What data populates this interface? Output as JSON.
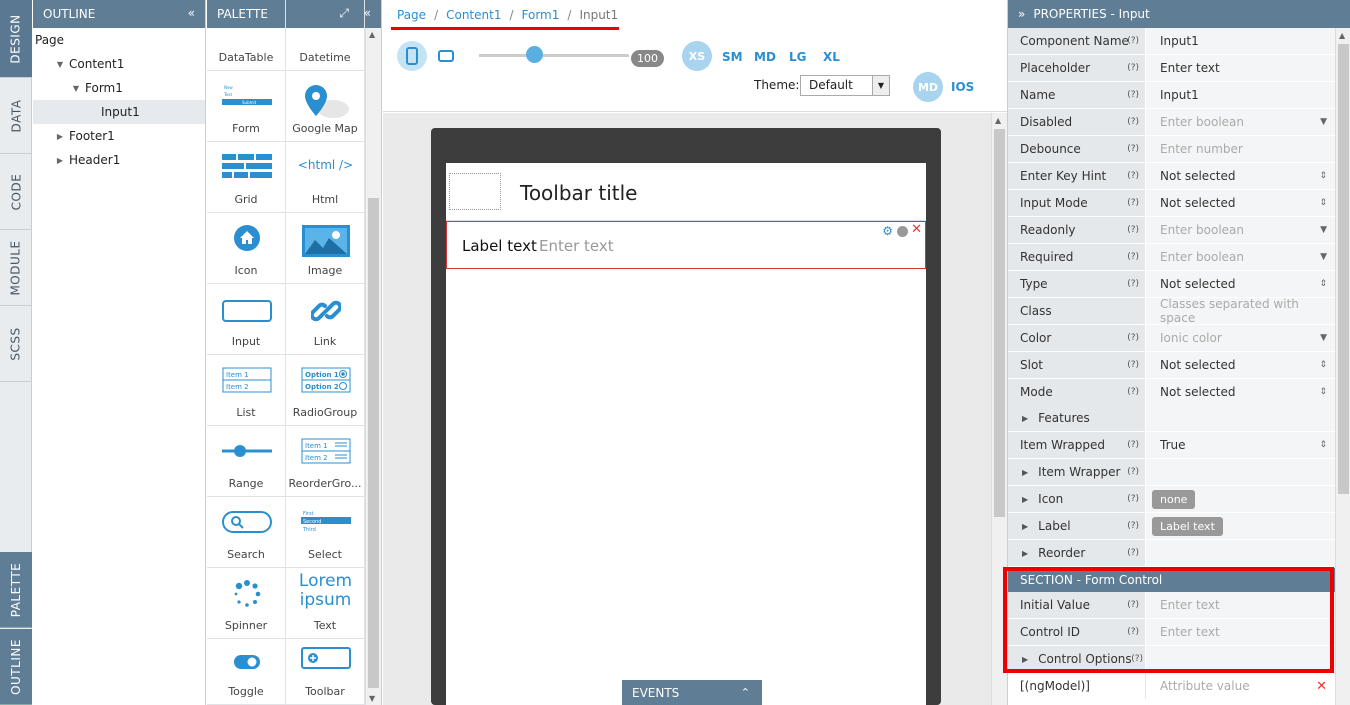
{
  "vtabs": {
    "design": "DESIGN",
    "data": "DATA",
    "code": "CODE",
    "module": "MODULE",
    "scss": "SCSS",
    "palette": "PALETTE",
    "outline": "OUTLINE"
  },
  "outline": {
    "title": "OUTLINE",
    "items": [
      {
        "label": "Page"
      },
      {
        "label": "Content1"
      },
      {
        "label": "Form1"
      },
      {
        "label": "Input1"
      },
      {
        "label": "Footer1"
      },
      {
        "label": "Header1"
      }
    ]
  },
  "palette": {
    "title": "PALETTE",
    "items": [
      {
        "label": "DataTable",
        "icon": "datatable-icon"
      },
      {
        "label": "Datetime",
        "icon": "datetime-icon"
      },
      {
        "label": "Form",
        "icon": "form-icon"
      },
      {
        "label": "Google Map",
        "icon": "map-pin-icon"
      },
      {
        "label": "Grid",
        "icon": "grid-icon"
      },
      {
        "label": "Html",
        "icon": "html-icon"
      },
      {
        "label": "Icon",
        "icon": "home-icon"
      },
      {
        "label": "Image",
        "icon": "image-icon"
      },
      {
        "label": "Input",
        "icon": "input-icon"
      },
      {
        "label": "Link",
        "icon": "link-icon"
      },
      {
        "label": "List",
        "icon": "list-icon"
      },
      {
        "label": "RadioGroup",
        "icon": "radiogroup-icon"
      },
      {
        "label": "Range",
        "icon": "range-icon"
      },
      {
        "label": "ReorderGro...",
        "icon": "reorder-icon"
      },
      {
        "label": "Search",
        "icon": "search-icon"
      },
      {
        "label": "Select",
        "icon": "select-icon"
      },
      {
        "label": "Spinner",
        "icon": "spinner-icon"
      },
      {
        "label": "Text",
        "icon": "text-icon"
      },
      {
        "label": "Toggle",
        "icon": "toggle-icon"
      },
      {
        "label": "Toolbar",
        "icon": "toolbar-icon"
      }
    ],
    "icon_text": {
      "html": "<html />",
      "lorem": "Lorem",
      "ipsum": "ipsum",
      "item1": "Item 1",
      "item2": "Item 2",
      "option1": "Option 1",
      "option2": "Option 2",
      "new": "New",
      "first": "First",
      "second": "Second",
      "third": "Third",
      "submit": "Submit"
    }
  },
  "breadcrumb": {
    "items": [
      "Page",
      "Content1",
      "Form1"
    ],
    "current": "Input1"
  },
  "toolbar": {
    "zoom": "100",
    "breakpoints": [
      "XS",
      "SM",
      "MD",
      "LG",
      "XL"
    ],
    "theme_label": "Theme:",
    "theme_value": "Default",
    "mode_md": "MD",
    "mode_ios": "IOS"
  },
  "preview": {
    "toolbar_title": "Toolbar title",
    "label_text": "Label text",
    "placeholder": "Enter text"
  },
  "events_label": "EVENTS",
  "properties": {
    "title": "PROPERTIES - Input",
    "rows": [
      {
        "label": "Component Name",
        "q": "(?)",
        "value": "Input1",
        "ph": false,
        "dd": ""
      },
      {
        "label": "Placeholder",
        "q": "(?)",
        "value": "Enter text",
        "ph": false,
        "dd": ""
      },
      {
        "label": "Name",
        "q": "(?)",
        "value": "Input1",
        "ph": false,
        "dd": ""
      },
      {
        "label": "Disabled",
        "q": "(?)",
        "value": "Enter boolean",
        "ph": true,
        "dd": "▼"
      },
      {
        "label": "Debounce",
        "q": "(?)",
        "value": "Enter number",
        "ph": true,
        "dd": ""
      },
      {
        "label": "Enter Key Hint",
        "q": "(?)",
        "value": "Not selected",
        "ph": false,
        "dd": "⇕"
      },
      {
        "label": "Input Mode",
        "q": "(?)",
        "value": "Not selected",
        "ph": false,
        "dd": "⇕"
      },
      {
        "label": "Readonly",
        "q": "(?)",
        "value": "Enter boolean",
        "ph": true,
        "dd": "▼"
      },
      {
        "label": "Required",
        "q": "(?)",
        "value": "Enter boolean",
        "ph": true,
        "dd": "▼"
      },
      {
        "label": "Type",
        "q": "(?)",
        "value": "Not selected",
        "ph": false,
        "dd": "⇕"
      },
      {
        "label": "Class",
        "q": "",
        "value": "Classes separated with space",
        "ph": true,
        "dd": ""
      },
      {
        "label": "Color",
        "q": "(?)",
        "value": "Ionic color",
        "ph": true,
        "dd": "▼"
      },
      {
        "label": "Slot",
        "q": "(?)",
        "value": "Not selected",
        "ph": false,
        "dd": "⇕"
      },
      {
        "label": "Mode",
        "q": "(?)",
        "value": "Not selected",
        "ph": false,
        "dd": "⇕"
      }
    ],
    "features": "Features",
    "item_wrapped": {
      "label": "Item Wrapped",
      "q": "(?)",
      "value": "True"
    },
    "item_wrapper": {
      "label": "Item Wrapper",
      "q": "(?)"
    },
    "icon": {
      "label": "Icon",
      "q": "(?)",
      "value": "none"
    },
    "label": {
      "label": "Label",
      "q": "(?)",
      "value": "Label text"
    },
    "reorder": {
      "label": "Reorder",
      "q": "(?)"
    },
    "section": "SECTION - Form Control",
    "form_rows": [
      {
        "label": "Initial Value",
        "q": "(?)",
        "value": "Enter text"
      },
      {
        "label": "Control ID",
        "q": "(?)",
        "value": "Enter text"
      }
    ],
    "control_options": {
      "label": "Control Options",
      "q": "(?)"
    },
    "ngmodel": {
      "label": "[(ngModel)]",
      "value": "Attribute value"
    }
  },
  "colors": {
    "header": "#5f7d95",
    "link": "#2a8fd1",
    "highlight": "#e00000"
  }
}
